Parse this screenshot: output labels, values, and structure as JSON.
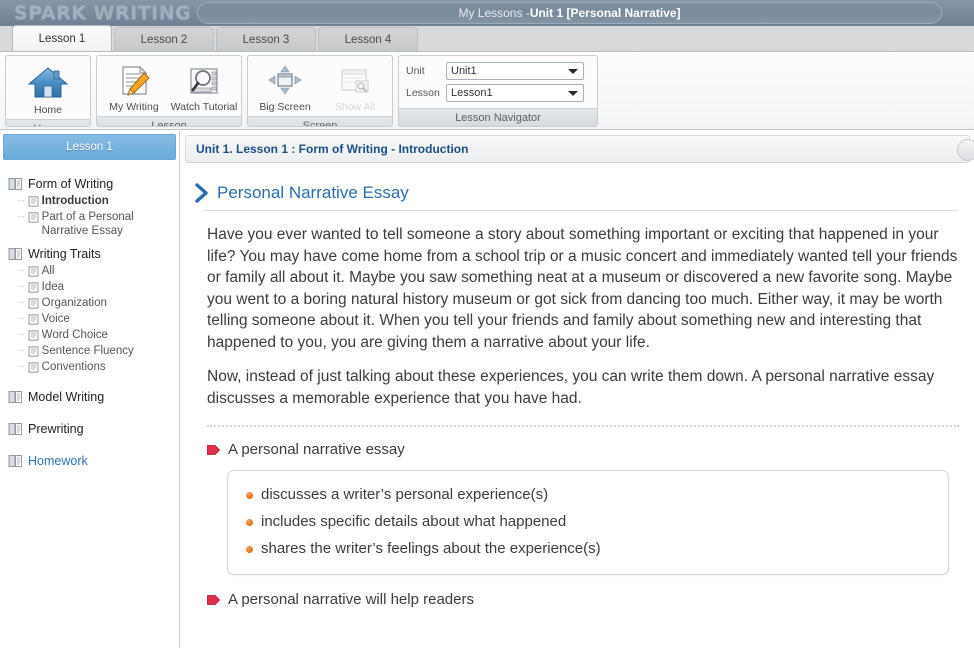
{
  "header": {
    "brand": "SPARK WRITING",
    "title_prefix": "My Lessons - ",
    "title_bold": "Unit 1 [Personal Narrative]"
  },
  "tabs": [
    {
      "label": "Lesson 1",
      "active": true
    },
    {
      "label": "Lesson 2",
      "active": false
    },
    {
      "label": "Lesson 3",
      "active": false
    },
    {
      "label": "Lesson 4",
      "active": false
    }
  ],
  "ribbon": {
    "groups": [
      {
        "caption": "Home",
        "buttons": [
          {
            "label": "Home",
            "icon": "home-icon",
            "disabled": false
          }
        ]
      },
      {
        "caption": "Lesson",
        "buttons": [
          {
            "label": "My Writing",
            "icon": "document-pencil-icon",
            "disabled": false
          },
          {
            "label": "Watch Tutorial",
            "icon": "film-magnifier-icon",
            "disabled": false
          }
        ]
      },
      {
        "caption": "Screen",
        "buttons": [
          {
            "label": "Big Screen",
            "icon": "expand-arrows-icon",
            "disabled": false
          },
          {
            "label": "Show All",
            "icon": "window-search-icon",
            "disabled": true
          }
        ]
      }
    ],
    "navigator": {
      "caption": "Lesson Navigator",
      "unit_label": "Unit",
      "unit_value": "Unit1",
      "lesson_label": "Lesson",
      "lesson_value": "Lesson1"
    }
  },
  "sidebar": {
    "header": "Lesson 1",
    "groups": [
      {
        "label": "Form of Writing",
        "icon": "book-icon",
        "link": false,
        "items": [
          {
            "label": "Introduction",
            "selected": true
          },
          {
            "label": "Part of a Personal Narrative Essay",
            "selected": false
          }
        ]
      },
      {
        "label": "Writing Traits",
        "icon": "book-icon",
        "link": false,
        "items": [
          {
            "label": "All",
            "selected": false
          },
          {
            "label": "Idea",
            "selected": false
          },
          {
            "label": "Organization",
            "selected": false
          },
          {
            "label": "Voice",
            "selected": false
          },
          {
            "label": "Word Choice",
            "selected": false
          },
          {
            "label": "Sentence Fluency",
            "selected": false
          },
          {
            "label": "Conventions",
            "selected": false
          }
        ]
      },
      {
        "label": "Model Writing",
        "icon": "book-icon",
        "link": false,
        "items": []
      },
      {
        "label": "Prewriting",
        "icon": "book-icon",
        "link": false,
        "items": []
      },
      {
        "label": "Homework",
        "icon": "book-icon",
        "link": true,
        "items": []
      }
    ]
  },
  "main": {
    "breadcrumb": "Unit 1. Lesson 1 : Form of Writing - Introduction",
    "section_title": "Personal Narrative Essay",
    "paragraph_1": "Have you ever wanted to tell someone a story about something important or exciting that happened in your life? You may have come home from a school trip or a music concert and immediately wanted tell your friends or family all about it. Maybe you saw something neat at a museum or discovered a new favorite song. Maybe you went to a boring natural history museum or got sick from dancing too much. Either way, it may be worth telling someone about it. When you tell your friends and family about something new and interesting that happened to you, you are giving them a narrative about your life.",
    "paragraph_2": "Now, instead of just talking about these experiences, you can write them down. A personal narrative essay discusses a memorable experience that you have had.",
    "flag_heading_1": "A personal narrative essay",
    "fact_items": [
      "discusses a writer’s personal experience(s)",
      "includes specific details about what happened",
      "shares the writer’s feelings about the experience(s)"
    ],
    "flag_heading_2": "A personal narrative will help readers"
  },
  "colors": {
    "header_bar": "#7a8c9e",
    "sidebar_header": "#6aaad9",
    "breadcrumb_text": "#1d4f87",
    "section_title": "#2b6cb0",
    "flag_red": "#e0304b",
    "bullet_orange": "#e8781e",
    "link_blue": "#2d73b5"
  }
}
